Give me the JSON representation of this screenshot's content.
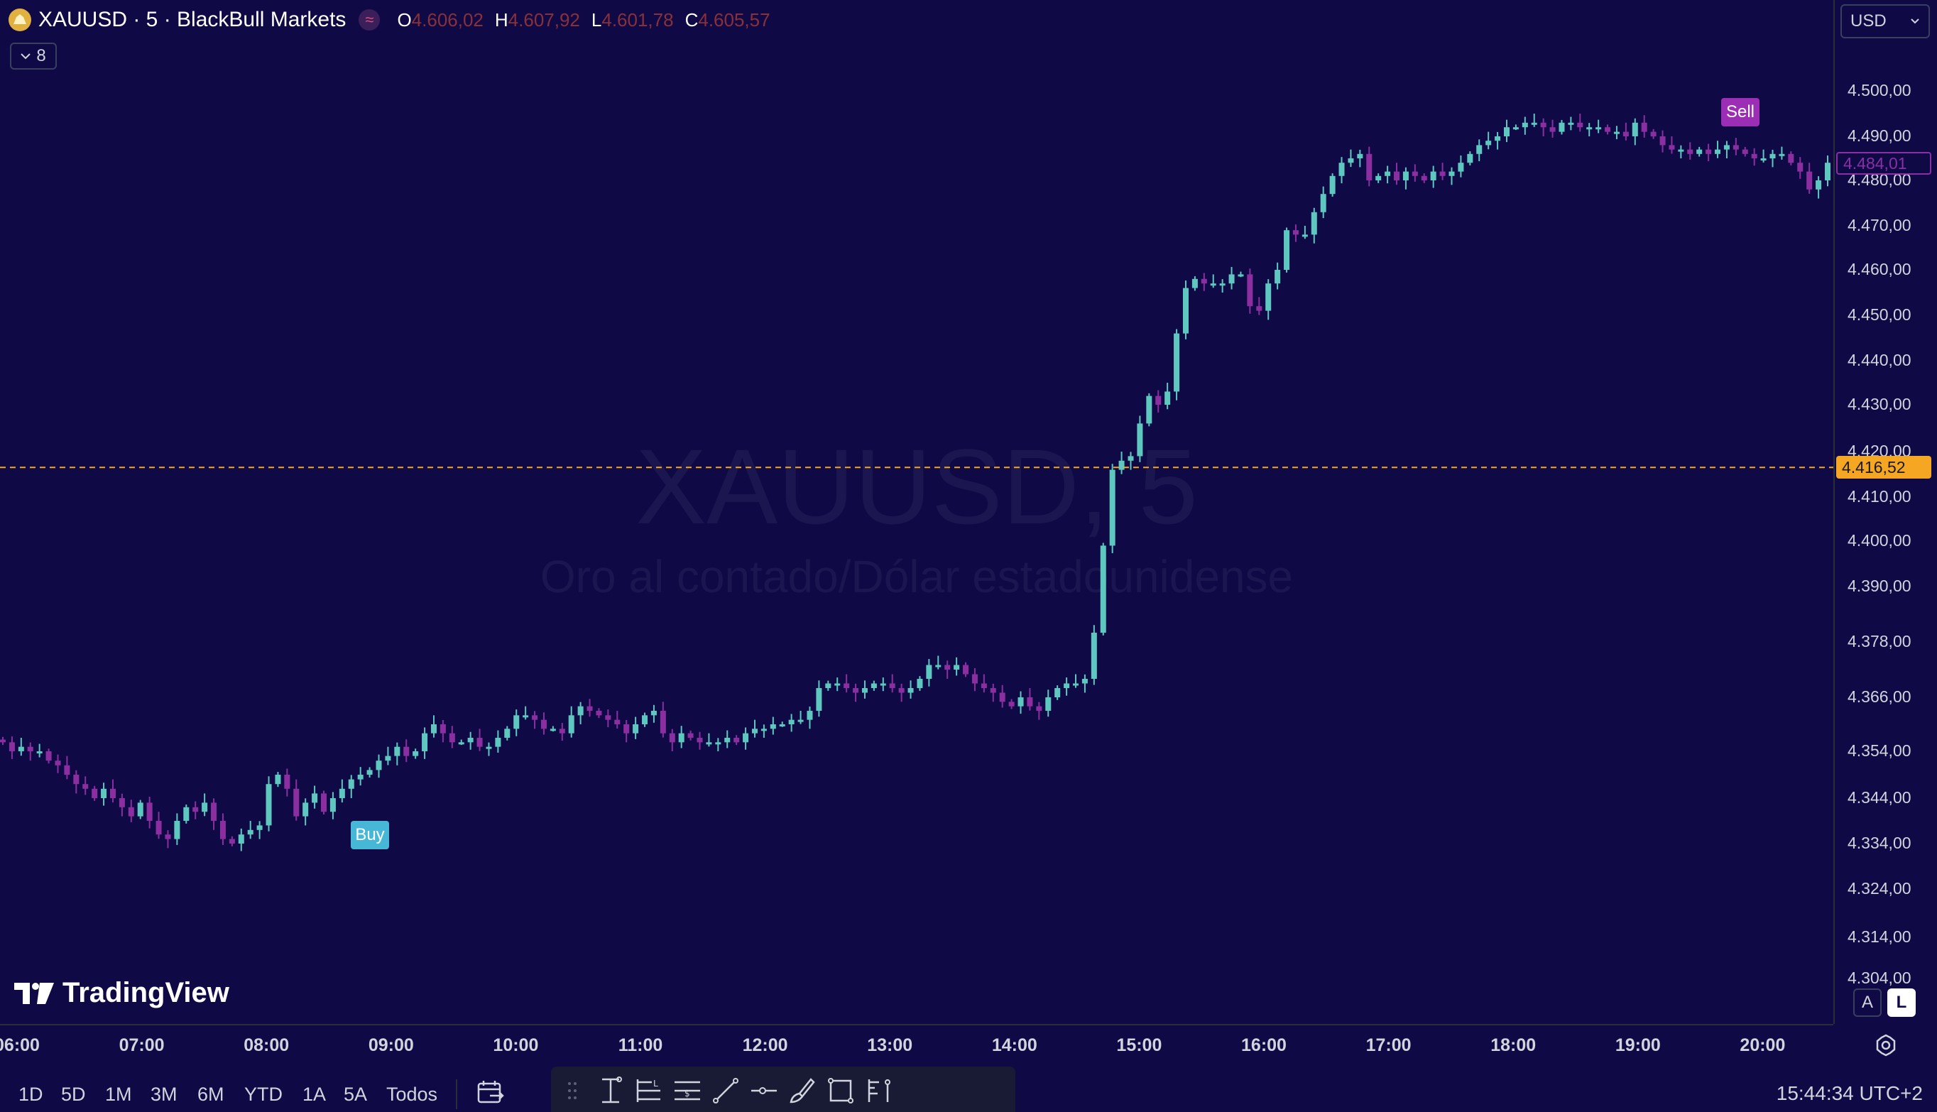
{
  "header": {
    "symbol_title": "XAUUSD · 5 · BlackBull Markets",
    "ohlc": [
      {
        "key": "O",
        "value": "4.606,02"
      },
      {
        "key": "H",
        "value": "4.607,92"
      },
      {
        "key": "L",
        "value": "4.601,78"
      },
      {
        "key": "C",
        "value": "4.605,57"
      }
    ],
    "indicators_count": "8",
    "currency": "USD"
  },
  "watermark": {
    "symbol": "XAUUSD, 5",
    "description": "Oro al contado/Dólar estadounidense"
  },
  "price_axis": {
    "labels": [
      "4.500,00",
      "4.490,00",
      "4.480,00",
      "4.470,00",
      "4.460,00",
      "4.450,00",
      "4.440,00",
      "4.430,00",
      "4.420,00",
      "4.410,00",
      "4.400,00",
      "4.390,00",
      "4.378,00",
      "4.366,00",
      "4.354,00",
      "4.344,00",
      "4.334,00",
      "4.324,00",
      "4.314,00",
      "4.304,00"
    ],
    "current_price": "4.484,01",
    "line_price": "4.416,52"
  },
  "time_axis": {
    "labels": [
      "06:00",
      "07:00",
      "08:00",
      "09:00",
      "10:00",
      "11:00",
      "12:00",
      "13:00",
      "14:00",
      "15:00",
      "16:00",
      "17:00",
      "18:00",
      "19:00",
      "20:00"
    ]
  },
  "signals": {
    "buy": "Buy",
    "sell": "Sell"
  },
  "branding": {
    "logo_text": "TradingView"
  },
  "scale_buttons": {
    "auto": "A",
    "log": "L"
  },
  "ranges": [
    "1D",
    "5D",
    "1M",
    "3M",
    "6M",
    "YTD",
    "1A",
    "5A",
    "Todos"
  ],
  "tools": [
    "drag-handle-icon",
    "measure-icon",
    "long-position-icon",
    "price-range-icon",
    "trend-line-icon",
    "horizontal-ray-icon",
    "brush-icon",
    "rectangle-icon",
    "fib-icon"
  ],
  "clock": "15:44:34 UTC+2",
  "colors": {
    "background": "#0f0a45",
    "up": "#5ec8c0",
    "down": "#8b2fa0",
    "line": "#f5a623"
  },
  "chart_data": {
    "type": "candlestick",
    "symbol": "XAUUSD",
    "interval": "5",
    "time_labels": [
      "06:00",
      "07:00",
      "08:00",
      "09:00",
      "10:00",
      "11:00",
      "12:00",
      "13:00",
      "14:00",
      "15:00",
      "16:00",
      "17:00",
      "18:00",
      "19:00",
      "20:00"
    ],
    "price_range": [
      4300,
      4504
    ],
    "horizontal_line": 4416.52,
    "last_price": 4484.01,
    "candle_closes": [
      4356,
      4354,
      4355,
      4354,
      4354,
      4352,
      4351,
      4349,
      4347,
      4346,
      4344,
      4346,
      4344,
      4342,
      4340,
      4343,
      4339,
      4336,
      4335,
      4339,
      4342,
      4341,
      4343,
      4339,
      4335,
      4334,
      4336,
      4337,
      4338,
      4347,
      4349,
      4346,
      4340,
      4343,
      4345,
      4341,
      4344,
      4346,
      4348,
      4349,
      4350,
      4352,
      4353,
      4355,
      4353,
      4354,
      4358,
      4360,
      4358,
      4356,
      4356,
      4357,
      4355,
      4355,
      4357,
      4359,
      4362,
      4362,
      4361,
      4359,
      4359,
      4358,
      4362,
      4364,
      4363,
      4362,
      4361,
      4360,
      4358,
      4360,
      4362,
      4363,
      4358,
      4356,
      4358,
      4357,
      4356,
      4356,
      4356,
      4357,
      4356,
      4358,
      4359,
      4359,
      4360,
      4360,
      4361,
      4361,
      4363,
      4368,
      4369,
      4369,
      4368,
      4367,
      4368,
      4369,
      4369,
      4368,
      4367,
      4368,
      4370,
      4373,
      4373,
      4372,
      4373,
      4371,
      4369,
      4368,
      4367,
      4365,
      4364,
      4366,
      4364,
      4363,
      4366,
      4368,
      4369,
      4369,
      4370,
      4380,
      4399,
      4416,
      4418,
      4419,
      4426,
      4432,
      4430,
      4433,
      4446,
      4456,
      4458,
      4457,
      4457,
      4457,
      4459,
      4459,
      4452,
      4451,
      4457,
      4460,
      4469,
      4468,
      4468,
      4473,
      4477,
      4481,
      4484,
      4485,
      4486,
      4480,
      4481,
      4482,
      4480,
      4482,
      4481,
      4480,
      4482,
      4481,
      4482,
      4484,
      4486,
      4488,
      4489,
      4490,
      4492,
      4492,
      4493,
      4493,
      4492,
      4491,
      4493,
      4493,
      4492,
      4492,
      4492,
      4491,
      4491,
      4490,
      4493,
      4491,
      4490,
      4488,
      4487,
      4487,
      4486,
      4487,
      4486,
      4487,
      4488,
      4487,
      4486,
      4485,
      4485,
      4486,
      4486,
      4484,
      4482,
      4478,
      4480,
      4484
    ]
  }
}
